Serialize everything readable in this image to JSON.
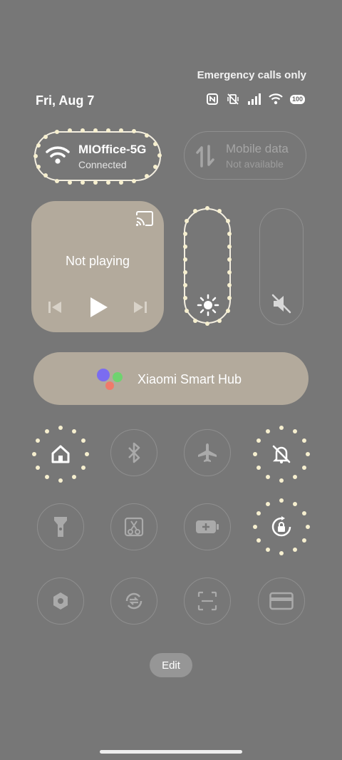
{
  "status": {
    "emergency": "Emergency calls only",
    "date": "Fri, Aug 7",
    "battery": "100",
    "icons": [
      "nfc-icon",
      "vibrate-off-icon",
      "signal-icon",
      "wifi-icon",
      "battery-icon"
    ]
  },
  "wifi": {
    "name": "MIOffice-5G",
    "state": "Connected"
  },
  "mobile": {
    "title": "Mobile data",
    "state": "Not available"
  },
  "media": {
    "title": "Not playing"
  },
  "hub": {
    "label": "Xiaomi Smart Hub"
  },
  "toggles": [
    {
      "name": "home-icon",
      "on": true
    },
    {
      "name": "bluetooth-icon",
      "on": false
    },
    {
      "name": "airplane-icon",
      "on": false
    },
    {
      "name": "mute-icon",
      "on": true
    },
    {
      "name": "flashlight-icon",
      "on": false
    },
    {
      "name": "screenshot-icon",
      "on": false
    },
    {
      "name": "battery-saver-icon",
      "on": false
    },
    {
      "name": "rotation-lock-icon",
      "on": true
    },
    {
      "name": "hexagon-settings-icon",
      "on": false
    },
    {
      "name": "sync-icon",
      "on": false
    },
    {
      "name": "scanner-icon",
      "on": false
    },
    {
      "name": "card-icon",
      "on": false
    }
  ],
  "edit_label": "Edit",
  "colors": {
    "background": "#777777",
    "tile": "#b3aa9c",
    "lights": "#f6efcf"
  }
}
